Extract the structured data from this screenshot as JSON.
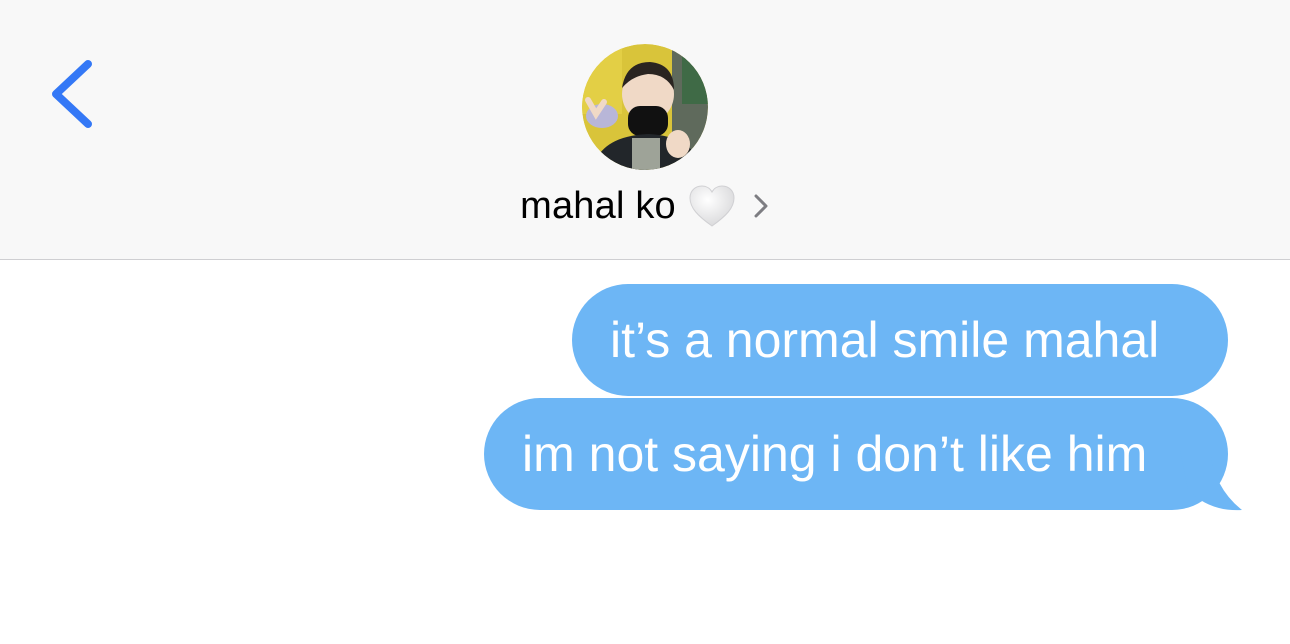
{
  "header": {
    "back_icon": "chevron-left-icon",
    "avatar_icon": "contact-avatar",
    "contact_name": "mahal ko",
    "heart_icon": "white-heart-icon",
    "chevron_icon": "chevron-right-icon"
  },
  "messages": [
    {
      "direction": "outgoing",
      "text": "it’s a normal smile mahal"
    },
    {
      "direction": "outgoing",
      "text": "im not saying i don’t like him"
    }
  ],
  "colors": {
    "accent": "#3478f6",
    "bubble": "#6db6f5",
    "header_bg": "#f8f8f8",
    "background": "#ffffff"
  }
}
